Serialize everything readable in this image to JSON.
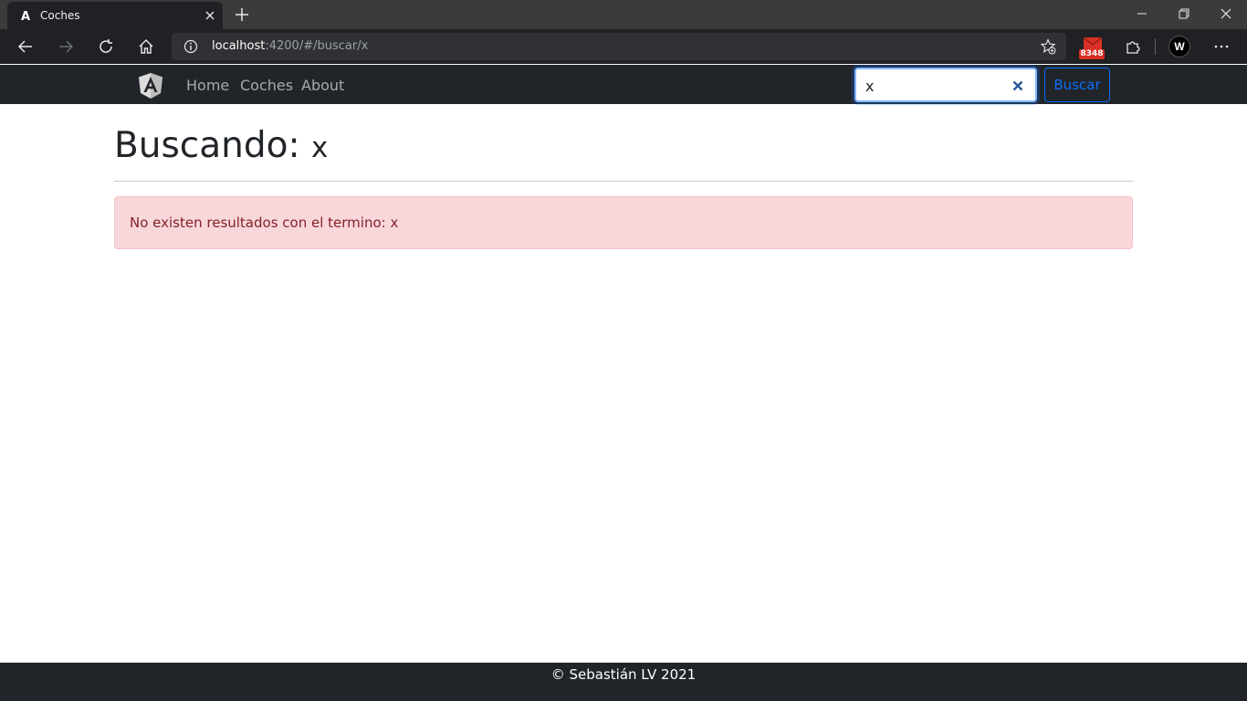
{
  "browser": {
    "tab_title": "Coches",
    "url_host": "localhost",
    "url_rest": ":4200/#/buscar/x",
    "mail_count": "8348",
    "profile_letter": "W"
  },
  "navbar": {
    "links": [
      "Home",
      "Coches",
      "About"
    ],
    "search_value": "x",
    "search_button": "Buscar"
  },
  "main": {
    "heading_prefix": "Buscando:",
    "heading_term": "x",
    "alert_text": "No existen resultados con el termino: x"
  },
  "footer": {
    "text": "© Sebastián LV 2021"
  },
  "colors": {
    "navbar_bg": "#212529",
    "primary": "#0d6efd",
    "alert_bg": "#f8d7da",
    "alert_text": "#842029"
  }
}
